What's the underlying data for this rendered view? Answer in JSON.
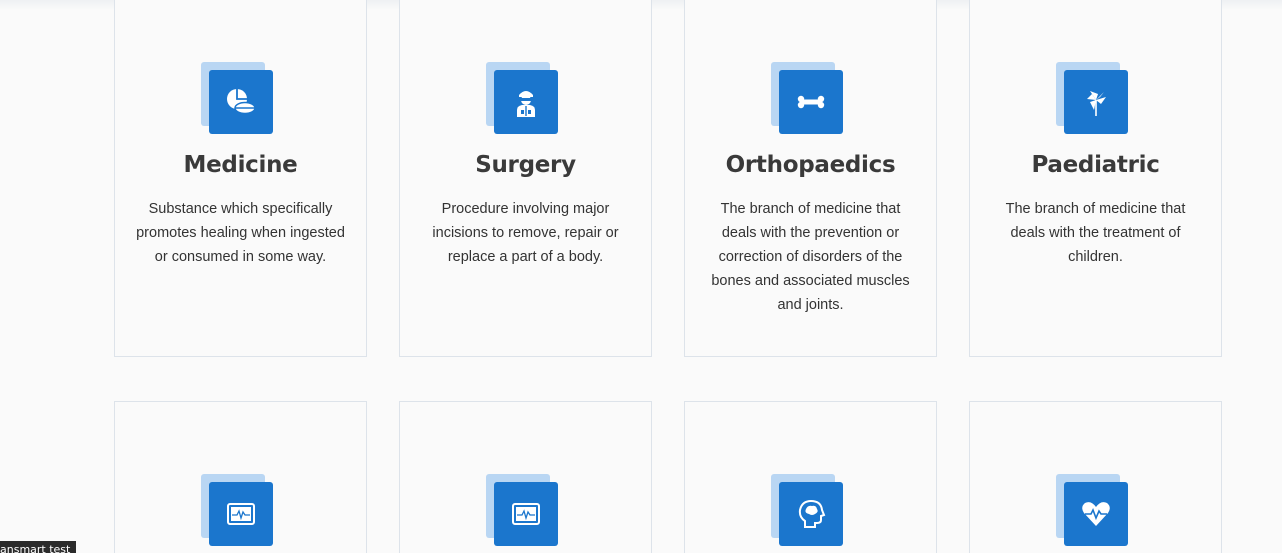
{
  "services": [
    {
      "icon": "pill-icon",
      "title": "Medicine",
      "description": "Substance which specifically promotes healing when ingested or consumed in some way."
    },
    {
      "icon": "surgeon-icon",
      "title": "Surgery",
      "description": "Procedure involving major incisions to remove, repair or replace a part of a body."
    },
    {
      "icon": "bone-icon",
      "title": "Orthopaedics",
      "description": "The branch of medicine that deals with the prevention or correction of disorders of the bones and associated muscles and joints."
    },
    {
      "icon": "pinwheel-icon",
      "title": "Paediatric",
      "description": "The branch of medicine that deals with the treatment of children."
    },
    {
      "icon": "heart-monitor-icon"
    },
    {
      "icon": "heart-monitor-icon"
    },
    {
      "icon": "brain-head-icon"
    },
    {
      "icon": "heartbeat-icon"
    }
  ],
  "tooltip": {
    "text": "ansmart test"
  },
  "colors": {
    "accent": "#1b76cd",
    "accent_light": "#b9d6f3",
    "card_border": "#dde3ea",
    "title": "#3a3a3a"
  }
}
